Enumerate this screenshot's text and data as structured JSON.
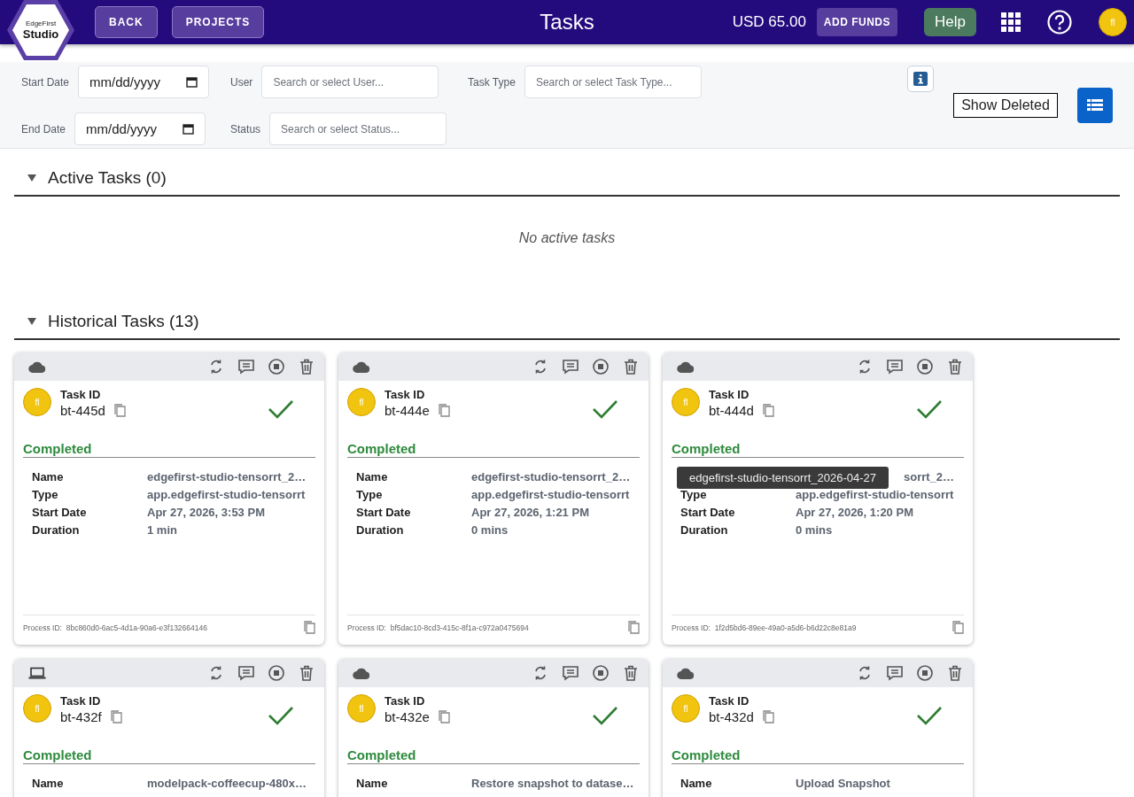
{
  "header": {
    "logo": {
      "small": "EdgeFirst",
      "large": "Studio"
    },
    "nav_buttons": [
      "BACK",
      "PROJECTS"
    ],
    "title": "Tasks",
    "balance": "USD 65.00",
    "add_funds": "ADD FUNDS",
    "help": "Help",
    "avatar": "fl"
  },
  "filters": {
    "start_date": {
      "label": "Start Date",
      "placeholder": "mm/dd/yyyy"
    },
    "end_date": {
      "label": "End Date",
      "placeholder": "mm/dd/yyyy"
    },
    "user": {
      "label": "User",
      "placeholder": "Search or select User..."
    },
    "status": {
      "label": "Status",
      "placeholder": "Search or select Status..."
    },
    "task_type": {
      "label": "Task Type",
      "placeholder": "Search or select Task Type..."
    },
    "show_deleted": "Show Deleted"
  },
  "sections": [
    {
      "title": "Active Tasks (0)",
      "expanded": true,
      "empty_text": "No active tasks"
    },
    {
      "title": "Historical Tasks (13)",
      "expanded": true
    }
  ],
  "tasks": [
    {
      "kind": "cloud",
      "avatar": "fl",
      "id_label": "Task ID",
      "id": "bt-445d",
      "status": "Completed",
      "fields": [
        {
          "label": "Name",
          "value": "edgefirst-studio-tensorrt_2…"
        },
        {
          "label": "Type",
          "value": "app.edgefirst-studio-tensorrt"
        },
        {
          "label": "Start Date",
          "value": "Apr 27, 2026, 3:53 PM"
        },
        {
          "label": "Duration",
          "value": "1 min"
        }
      ],
      "process_label": "Process ID:",
      "process_id": "8bc860d0-6ac5-4d1a-90a6-e3f132664146"
    },
    {
      "kind": "cloud",
      "avatar": "fl",
      "id_label": "Task ID",
      "id": "bt-444e",
      "status": "Completed",
      "fields": [
        {
          "label": "Name",
          "value": "edgefirst-studio-tensorrt_2…"
        },
        {
          "label": "Type",
          "value": "app.edgefirst-studio-tensorrt"
        },
        {
          "label": "Start Date",
          "value": "Apr 27, 2026, 1:21 PM"
        },
        {
          "label": "Duration",
          "value": "0 mins"
        }
      ],
      "process_label": "Process ID:",
      "process_id": "bf5dac10-8cd3-415c-8f1a-c972a0475694"
    },
    {
      "kind": "cloud",
      "avatar": "fl",
      "id_label": "Task ID",
      "id": "bt-444d",
      "status": "Completed",
      "tooltip": "edgefirst-studio-tensorrt_2026-04-27",
      "fields": [
        {
          "kind": "covered",
          "value": "sorrt_2…"
        },
        {
          "label": "Type",
          "value": "app.edgefirst-studio-tensorrt"
        },
        {
          "label": "Start Date",
          "value": "Apr 27, 2026, 1:20 PM"
        },
        {
          "label": "Duration",
          "value": "0 mins"
        }
      ],
      "process_label": "Process ID:",
      "process_id": "1f2d5bd6-89ee-49a0-a5d6-b6d22c8e81a9"
    },
    {
      "kind": "laptop",
      "avatar": "fl",
      "id_label": "Task ID",
      "id": "bt-432f",
      "status": "Completed",
      "fields": [
        {
          "label": "Name",
          "value": "modelpack-coffeecup-480x…"
        }
      ]
    },
    {
      "kind": "cloud",
      "avatar": "fl",
      "id_label": "Task ID",
      "id": "bt-432e",
      "status": "Completed",
      "fields": [
        {
          "label": "Name",
          "value": "Restore snapshot to datase…"
        }
      ]
    },
    {
      "kind": "cloud",
      "avatar": "fl",
      "id_label": "Task ID",
      "id": "bt-432d",
      "status": "Completed",
      "fields": [
        {
          "label": "Name",
          "value": "Upload Snapshot"
        }
      ]
    }
  ]
}
